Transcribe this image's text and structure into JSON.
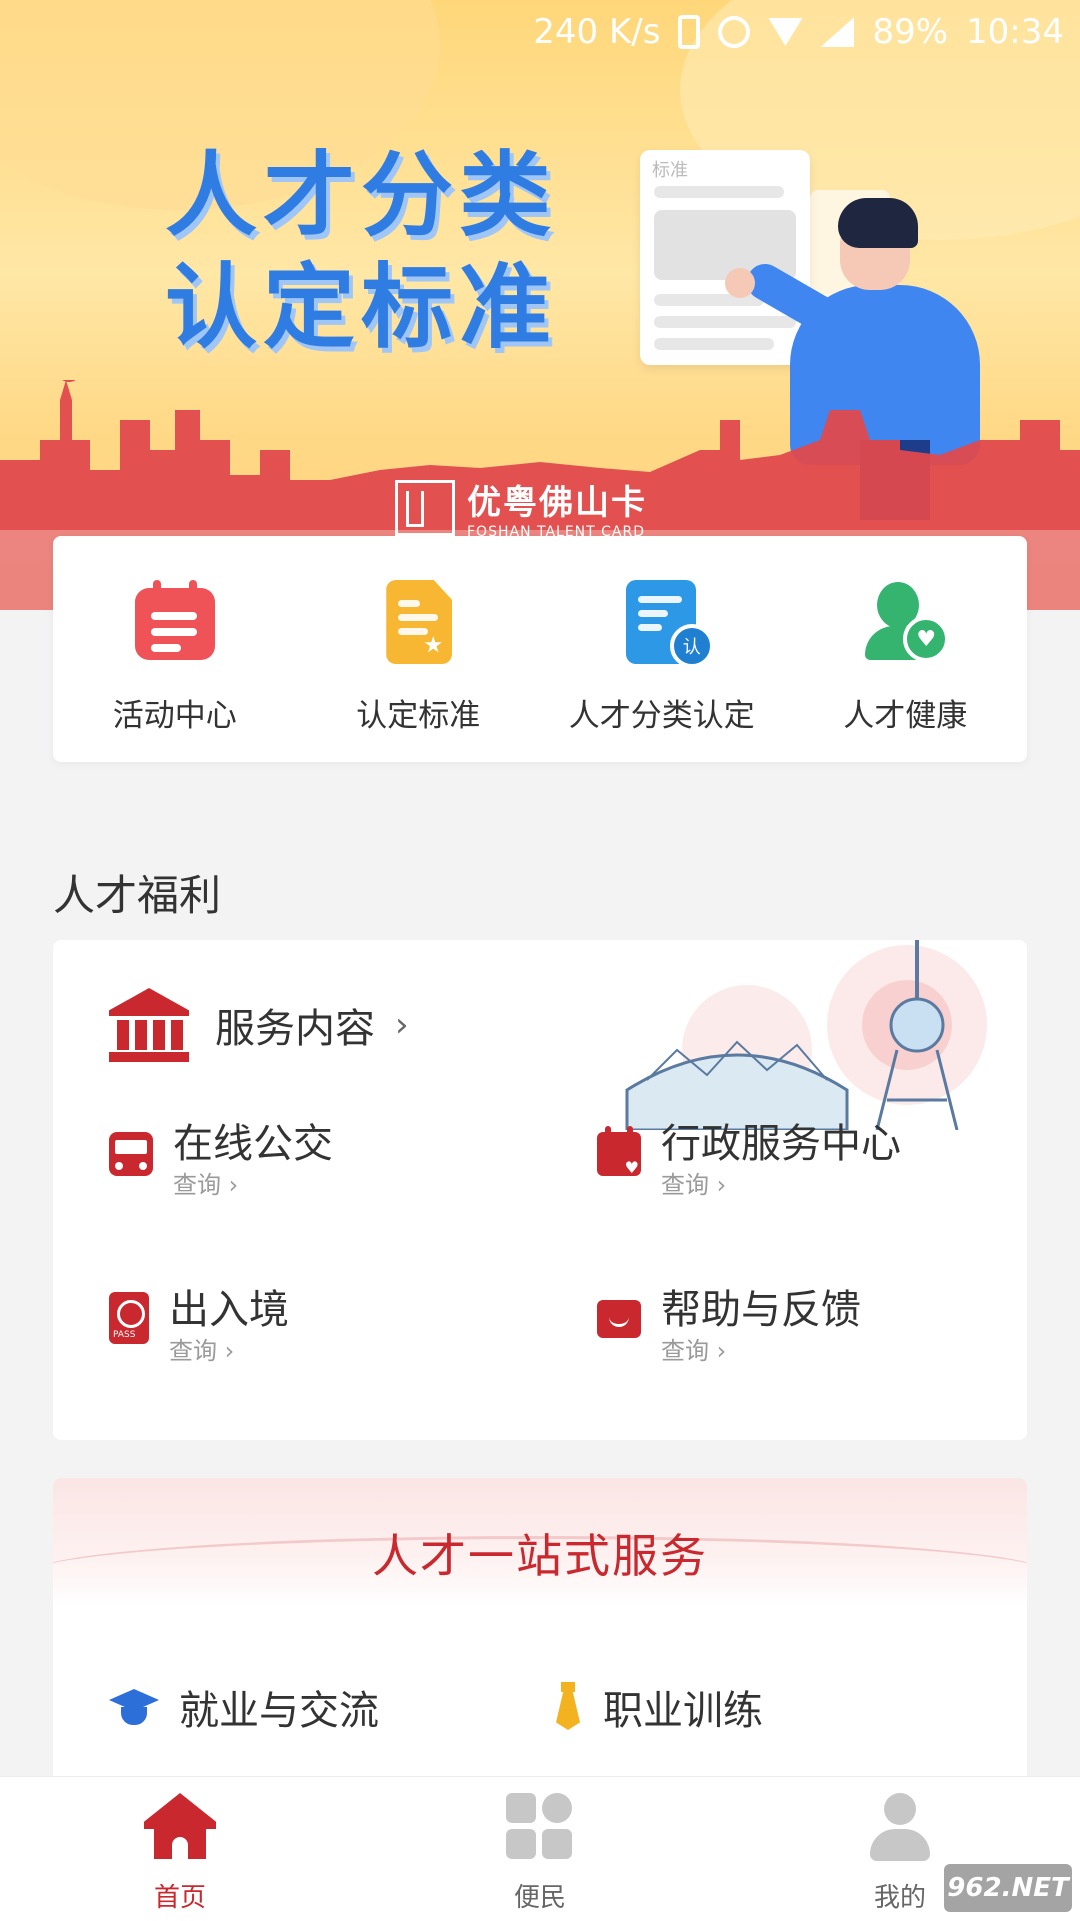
{
  "status_bar": {
    "speed": "240 K/s",
    "battery": "89%",
    "time": "10:34"
  },
  "hero": {
    "title_line1": "人才分类",
    "title_line2": "认定标准",
    "doc_title": "标准",
    "logo_cn": "优粤佛山卡",
    "logo_en": "FOSHAN TALENT CARD"
  },
  "quick_actions": [
    {
      "label": "活动中心",
      "icon": "calendar-list-icon"
    },
    {
      "label": "认定标准",
      "icon": "document-star-icon"
    },
    {
      "label": "人才分类认定",
      "icon": "document-certify-icon"
    },
    {
      "label": "人才健康",
      "icon": "person-heart-icon"
    }
  ],
  "welfare": {
    "section_title": "人才福利",
    "service_content": "服务内容",
    "arrow": "›",
    "services": [
      {
        "name": "在线公交",
        "sub": "查询 ›",
        "icon": "bus-icon"
      },
      {
        "name": "行政服务中心",
        "sub": "查询 ›",
        "icon": "calendar-heart-icon"
      },
      {
        "name": "出入境",
        "sub": "查询 ›",
        "icon": "passport-icon"
      },
      {
        "name": "帮助与反馈",
        "sub": "查询 ›",
        "icon": "message-icon"
      }
    ]
  },
  "onestop": {
    "title": "人才一站式服务",
    "items": [
      {
        "label": "就业与交流",
        "icon": "graduation-cap-icon"
      },
      {
        "label": "职业训练",
        "icon": "tie-icon"
      }
    ]
  },
  "bottom_nav": [
    {
      "label": "首页",
      "active": true
    },
    {
      "label": "便民",
      "active": false
    },
    {
      "label": "我的",
      "active": false
    }
  ],
  "watermark": "962.NET",
  "colors": {
    "brand_red": "#c9282e",
    "hero_yellow": "#ffd77a",
    "title_blue": "#2f7ce3"
  }
}
